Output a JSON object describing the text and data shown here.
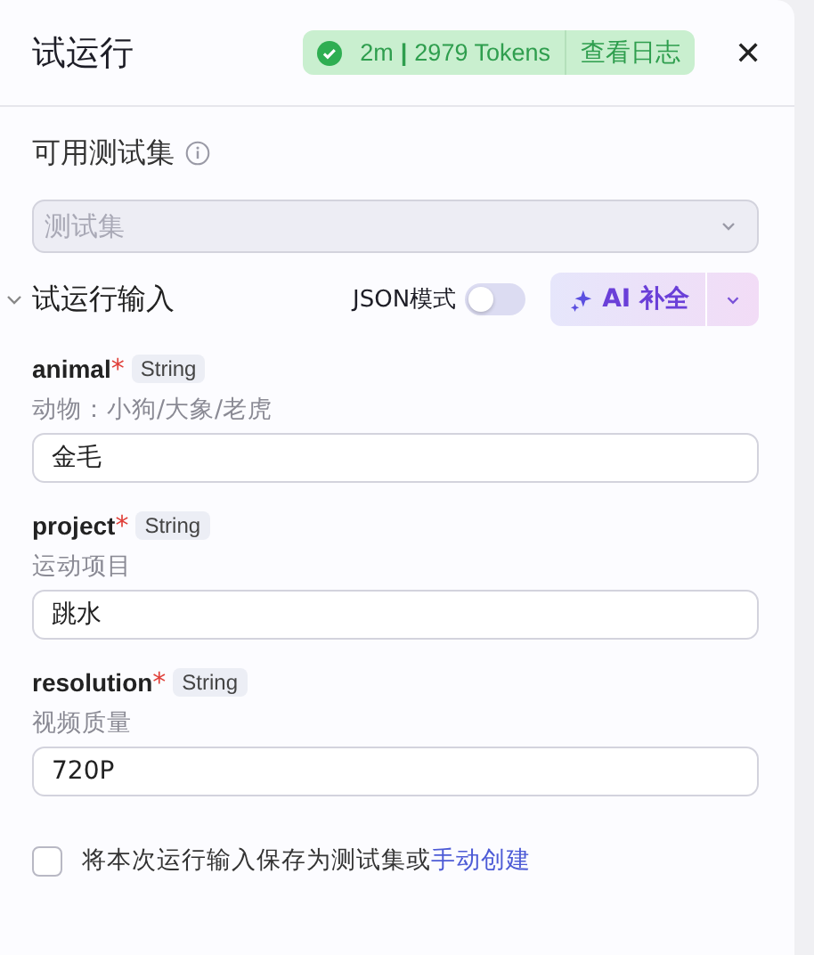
{
  "header": {
    "title": "试运行",
    "status": {
      "kind": "success",
      "duration": "2m",
      "separator": "|",
      "tokens": "2979 Tokens",
      "log_link": "查看日志"
    },
    "close": "✕"
  },
  "test_set": {
    "label": "可用测试集",
    "select": {
      "placeholder": "测试集",
      "disabled": true
    }
  },
  "input_section": {
    "title": "试运行输入",
    "expanded": true,
    "json_mode": {
      "label": "JSON模式",
      "on": false
    },
    "ai_button": "AI 补全"
  },
  "fields": [
    {
      "name": "animal",
      "required_mark": "*",
      "type": "String",
      "description": "动物：小狗/大象/老虎",
      "value": "金毛"
    },
    {
      "name": "project",
      "required_mark": "*",
      "type": "String",
      "description": "运动项目",
      "value": "跳水"
    },
    {
      "name": "resolution",
      "required_mark": "*",
      "type": "String",
      "description": "视频质量",
      "value": "720P"
    }
  ],
  "save_option": {
    "checked": false,
    "text": "将本次运行输入保存为测试集或",
    "link": "手动创建"
  }
}
